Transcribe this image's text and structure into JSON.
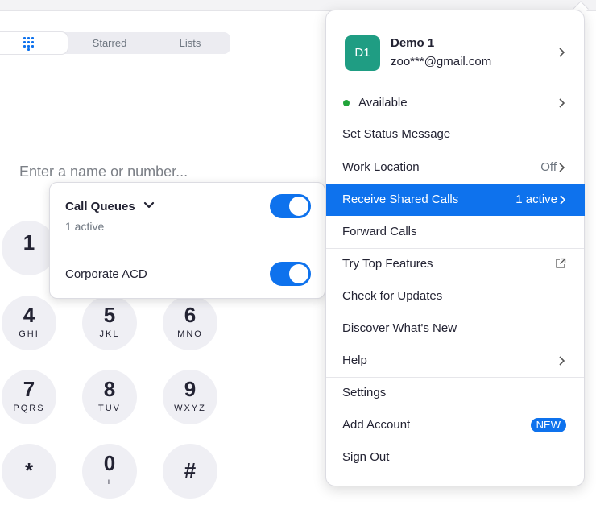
{
  "tabs": {
    "keypad_icon": "grid-icon",
    "starred_label": "Starred",
    "lists_label": "Lists"
  },
  "dialer": {
    "placeholder": "Enter a name or number..."
  },
  "keypad": {
    "k1": {
      "digit": "1",
      "letters": ""
    },
    "k4": {
      "digit": "4",
      "letters": "GHI"
    },
    "k5": {
      "digit": "5",
      "letters": "JKL"
    },
    "k6": {
      "digit": "6",
      "letters": "MNO"
    },
    "k7": {
      "digit": "7",
      "letters": "PQRS"
    },
    "k8": {
      "digit": "8",
      "letters": "TUV"
    },
    "k9": {
      "digit": "9",
      "letters": "WXYZ"
    },
    "kstar": {
      "digit": "*",
      "letters": ""
    },
    "k0": {
      "digit": "0",
      "letters": "+"
    },
    "khash": {
      "digit": "#",
      "letters": ""
    }
  },
  "call_queues": {
    "title": "Call Queues",
    "subtitle": "1 active",
    "enabled": true,
    "items": [
      {
        "label": "Corporate ACD",
        "enabled": true
      }
    ]
  },
  "account_menu": {
    "profile": {
      "initials": "D1",
      "name": "Demo 1",
      "email": "zoo***@gmail.com",
      "avatar_color": "#1f9d83"
    },
    "status": {
      "label": "Available",
      "dot_color": "#21a439"
    },
    "set_status": "Set Status Message",
    "work_location": {
      "label": "Work Location",
      "value": "Off"
    },
    "receive_shared_calls": {
      "label": "Receive Shared Calls",
      "value": "1 active"
    },
    "forward_calls": "Forward Calls",
    "try_top_features": "Try Top Features",
    "check_updates": "Check for Updates",
    "discover_new": "Discover What's New",
    "help": "Help",
    "settings": "Settings",
    "add_account": {
      "label": "Add Account",
      "badge": "NEW"
    },
    "sign_out": "Sign Out"
  },
  "colors": {
    "accent": "#0e72ed",
    "key_bg": "#efeff4"
  }
}
